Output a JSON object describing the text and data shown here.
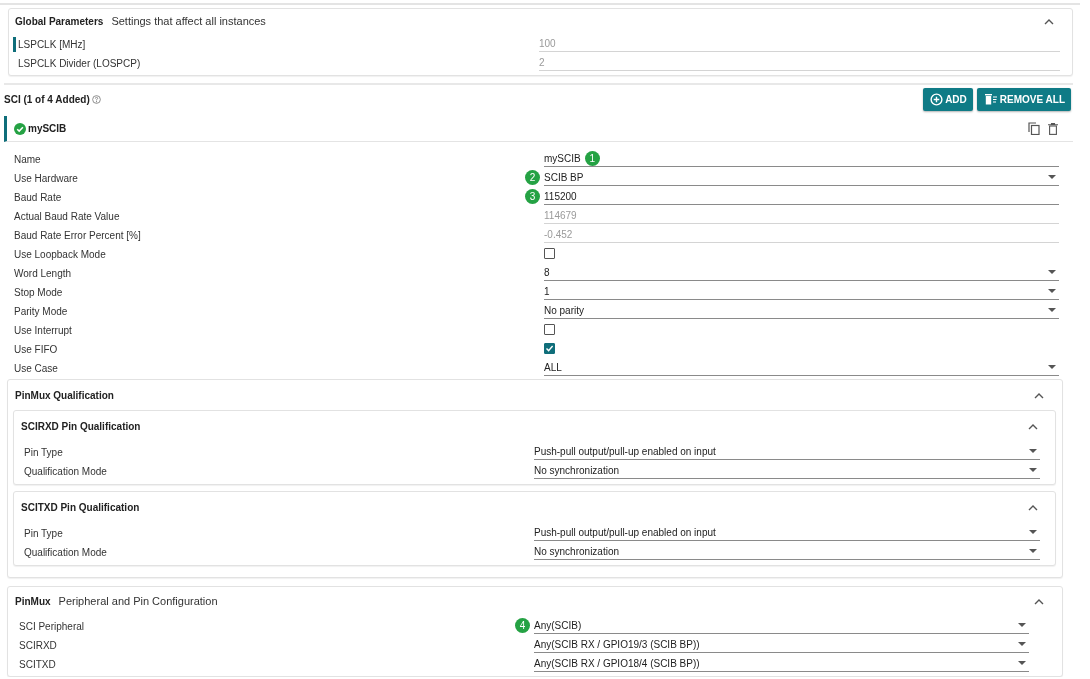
{
  "global": {
    "title": "Global Parameters",
    "subtitle": "Settings that affect all instances",
    "expanded": true,
    "rows": [
      {
        "label": "LSPCLK [MHz]",
        "kind": "readonly",
        "value": "100",
        "selected": true
      },
      {
        "label": "LSPCLK Divider (LOSPCP)",
        "kind": "readonly",
        "value": "2",
        "selected": false
      }
    ]
  },
  "sci": {
    "title": "SCI (1 of 4 Added)",
    "buttons": [
      {
        "label": "ADD",
        "kind": "add"
      },
      {
        "label": "REMOVE ALL",
        "kind": "remove"
      }
    ],
    "instance": {
      "name": "mySCIB",
      "valid": true,
      "selected": true
    },
    "fields": [
      {
        "label": "Name",
        "kind": "text",
        "value": "mySCIB",
        "badge": {
          "text": "1",
          "trailing": true
        }
      },
      {
        "label": "Use Hardware",
        "kind": "select",
        "value": "SCIB BP",
        "badge": {
          "text": "2",
          "trailing": false
        }
      },
      {
        "label": "Baud Rate",
        "kind": "text",
        "value": "115200",
        "badge": {
          "text": "3",
          "trailing": false
        }
      },
      {
        "label": "Actual Baud Rate Value",
        "kind": "readonly",
        "value": "114679"
      },
      {
        "label": "Baud Rate Error Percent [%]",
        "kind": "readonly",
        "value": "-0.452"
      },
      {
        "label": "Use Loopback Mode",
        "kind": "checkbox",
        "checked": false
      },
      {
        "label": "Word Length",
        "kind": "select",
        "value": "8"
      },
      {
        "label": "Stop Mode",
        "kind": "select",
        "value": "1"
      },
      {
        "label": "Parity Mode",
        "kind": "select",
        "value": "No parity"
      },
      {
        "label": "Use Interrupt",
        "kind": "checkbox",
        "checked": false
      },
      {
        "label": "Use FIFO",
        "kind": "checkbox",
        "checked": true
      },
      {
        "label": "Use Case",
        "kind": "select",
        "value": "ALL"
      }
    ]
  },
  "qualification": {
    "title": "PinMux Qualification",
    "expanded": true,
    "groups": [
      {
        "title": "SCIRXD Pin Qualification",
        "expanded": true,
        "rows": [
          {
            "label": "Pin Type",
            "kind": "select",
            "value": "Push-pull output/pull-up enabled on input"
          },
          {
            "label": "Qualification Mode",
            "kind": "select",
            "value": "No synchronization"
          }
        ]
      },
      {
        "title": "SCITXD Pin Qualification",
        "expanded": true,
        "rows": [
          {
            "label": "Pin Type",
            "kind": "select",
            "value": "Push-pull output/pull-up enabled on input"
          },
          {
            "label": "Qualification Mode",
            "kind": "select",
            "value": "No synchronization"
          }
        ]
      }
    ]
  },
  "pinmux": {
    "title": "PinMux",
    "subtitle": "Peripheral and Pin Configuration",
    "expanded": true,
    "rows": [
      {
        "label": "SCI Peripheral",
        "kind": "select",
        "value": "Any(SCIB)",
        "badge": {
          "text": "4",
          "trailing": false
        }
      },
      {
        "label": "SCIRXD",
        "kind": "select",
        "value": "Any(SCIB RX / GPIO19/3 (SCIB BP))"
      },
      {
        "label": "SCITXD",
        "kind": "select",
        "value": "Any(SCIB RX / GPIO18/4 (SCIB BP))"
      }
    ]
  }
}
